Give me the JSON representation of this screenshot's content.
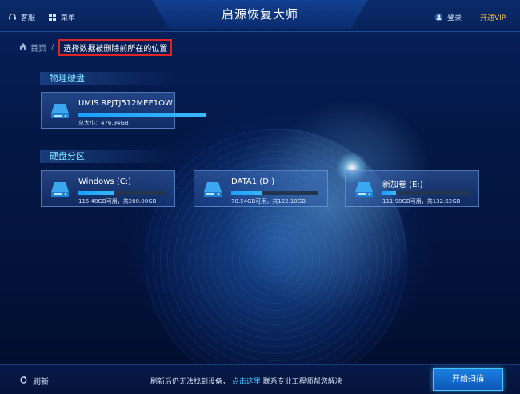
{
  "titlebar": {
    "title": "启源恢复大师",
    "support_label": "客服",
    "menu_label": "菜单",
    "login_label": "登录",
    "vip_label": "开通VIP"
  },
  "breadcrumb": {
    "home": "首页",
    "separator": "/",
    "current": "选择数据被删除前所在的位置"
  },
  "sections": {
    "physical": "物理硬盘",
    "partitions": "硬盘分区"
  },
  "physical_disks": [
    {
      "name": "UMIS RPJTJ512MEE1OW",
      "info": "总大小：476.94GB",
      "usage_fraction": 1.0
    }
  ],
  "partitions": [
    {
      "name": "Windows (C:)",
      "info": "115.48GB可用，共200.00GB",
      "usage_fraction": 0.42
    },
    {
      "name": "DATA1 (D:)",
      "info": "78.54GB可用，共122.10GB",
      "usage_fraction": 0.36
    },
    {
      "name": "新加卷 (E:)",
      "info": "111.90GB可用，共132.62GB",
      "usage_fraction": 0.16
    }
  ],
  "bottombar": {
    "refresh_label": "刷新",
    "help_prefix": "刷新后仍无法找到设备，",
    "help_link": "点击这里",
    "help_suffix": "联系专业工程师帮您解决",
    "scan_label": "开始扫描"
  },
  "colors": {
    "accent": "#39b8ff",
    "vip": "#f2c14e",
    "highlight_border": "#e02424"
  },
  "icons": [
    "support-icon",
    "menu-icon",
    "user-icon",
    "home-icon",
    "disk-icon",
    "refresh-icon"
  ]
}
